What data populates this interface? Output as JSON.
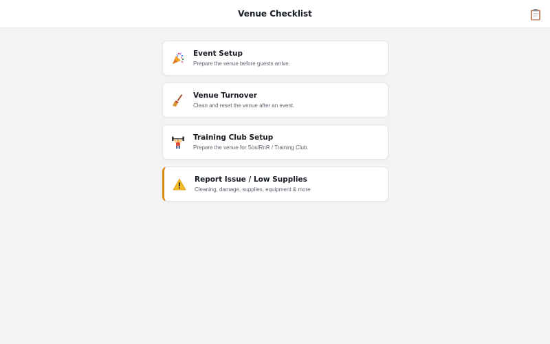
{
  "header": {
    "title": "Venue Checklist",
    "action_icon": "clipboard-icon"
  },
  "cards": [
    {
      "id": "event-setup",
      "label": "Event Setup",
      "description": "Prepare the venue before guests arrive.",
      "icon": "party-popper-icon"
    },
    {
      "id": "venue-turnover",
      "label": "Venue Turnover",
      "description": "Clean and reset the venue after an event.",
      "icon": "broom-icon"
    },
    {
      "id": "training-club-setup",
      "label": "Training Club Setup",
      "description": "Prepare the venue for SoulRnR / Training Club.",
      "icon": "weightlifter-icon"
    },
    {
      "id": "report-issue",
      "label": "Report Issue / Low Supplies",
      "description": "Cleaning, damage, supplies, equipment & more",
      "icon": "warning-icon",
      "accent_color": "#e08a16"
    }
  ],
  "colors": {
    "background": "#f3f3f5",
    "card": "#ffffff",
    "warning_accent": "#e08a16"
  }
}
